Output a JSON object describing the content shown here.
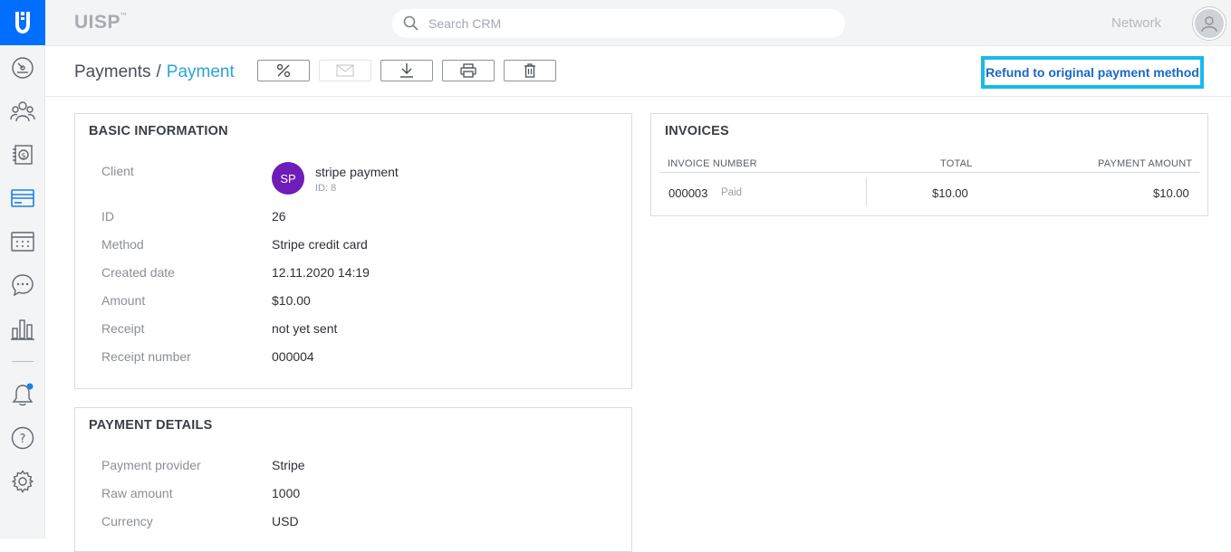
{
  "app": {
    "brand": "UISP",
    "brand_mark": "™"
  },
  "topbar": {
    "search_placeholder": "Search CRM",
    "network_label": "Network"
  },
  "sidebar": {
    "items": [
      "dashboard",
      "clients",
      "billing",
      "payments",
      "scheduling",
      "messages",
      "reports",
      "notifications",
      "help",
      "settings"
    ]
  },
  "header": {
    "breadcrumb_parent": "Payments",
    "breadcrumb_separator": "/",
    "breadcrumb_current": "Payment",
    "refund_label": "Refund to original payment method"
  },
  "basic_info": {
    "title": "BASIC INFORMATION",
    "client_label": "Client",
    "client_initials": "SP",
    "client_name": "stripe payment",
    "client_id": "ID: 8",
    "rows": [
      {
        "label": "ID",
        "value": "26"
      },
      {
        "label": "Method",
        "value": "Stripe credit card"
      },
      {
        "label": "Created date",
        "value": "12.11.2020 14:19"
      },
      {
        "label": "Amount",
        "value": "$10.00"
      },
      {
        "label": "Receipt",
        "value": "not yet sent"
      },
      {
        "label": "Receipt number",
        "value": "000004"
      }
    ]
  },
  "payment_details": {
    "title": "PAYMENT DETAILS",
    "rows": [
      {
        "label": "Payment provider",
        "value": "Stripe"
      },
      {
        "label": "Raw amount",
        "value": "1000"
      },
      {
        "label": "Currency",
        "value": "USD"
      }
    ]
  },
  "invoices": {
    "title": "INVOICES",
    "columns": [
      "INVOICE NUMBER",
      "TOTAL",
      "PAYMENT AMOUNT"
    ],
    "rows": [
      {
        "number": "000003",
        "status": "Paid",
        "total": "$10.00",
        "payment_amount": "$10.00"
      }
    ]
  },
  "colors": {
    "accent": "#006fff",
    "link": "#2aa3dc",
    "refund_border": "#19b9ee",
    "avatar": "#6e1db8"
  }
}
